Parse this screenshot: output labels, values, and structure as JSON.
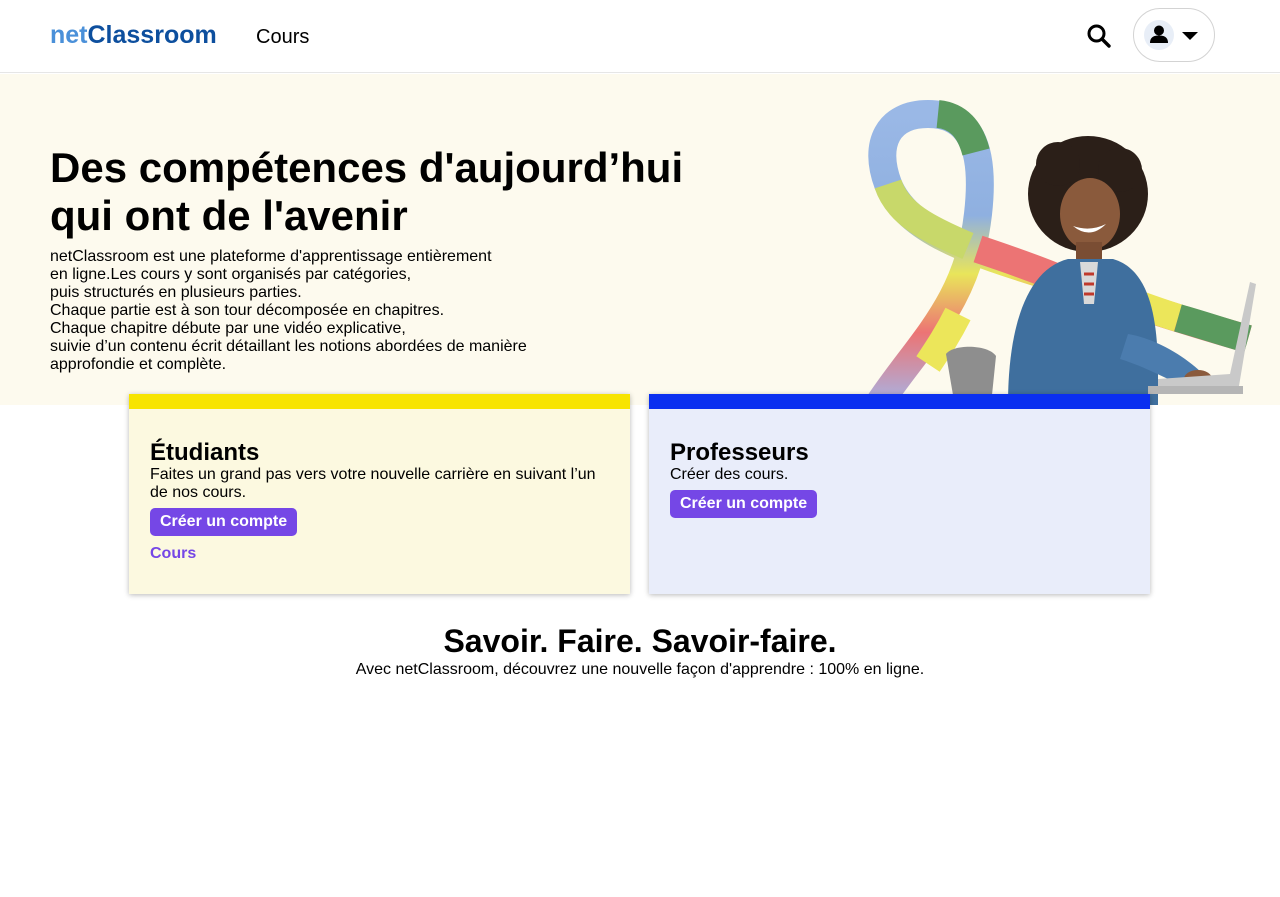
{
  "header": {
    "logo_prefix": "net",
    "logo_suffix": "Classroom",
    "nav_courses": "Cours",
    "search_icon": "search-icon",
    "user_icon": "user-icon",
    "dropdown_icon": "caret-down-icon"
  },
  "hero": {
    "title_line1": "Des compétences d'aujourd’hui",
    "title_line2": "qui ont de l'avenir",
    "description_lines": [
      "netClassroom est une plateforme d'apprentissage entièrement",
      "en ligne.Les cours y sont organisés par catégories,",
      "puis structurés en plusieurs parties.",
      "Chaque partie est à son tour décomposée en chapitres.",
      "Chaque chapitre débute par une vidéo explicative,",
      "suivie d’un contenu écrit détaillant les notions abordées de manière",
      "approfondie et complète."
    ],
    "background_color": "#fdfaee"
  },
  "cards": {
    "students": {
      "title": "Étudiants",
      "text": "Faites un grand pas vers votre nouvelle carrière en suivant l’un de nos cours.",
      "button_label": "Créer un compte",
      "link_label": "Cours",
      "accent_color": "#f7e400"
    },
    "teachers": {
      "title": "Professeurs",
      "text": "Créer des cours.",
      "button_label": "Créer un compte",
      "accent_color": "#0a2ff0"
    }
  },
  "tagline": {
    "title": "Savoir. Faire. Savoir-faire.",
    "subtitle": "Avec netClassroom, découvrez une nouvelle façon d'apprendre : 100% en ligne."
  },
  "colors": {
    "brand_light": "#4a90d9",
    "brand_dark": "#0d4f9e",
    "button": "#7547e6"
  }
}
